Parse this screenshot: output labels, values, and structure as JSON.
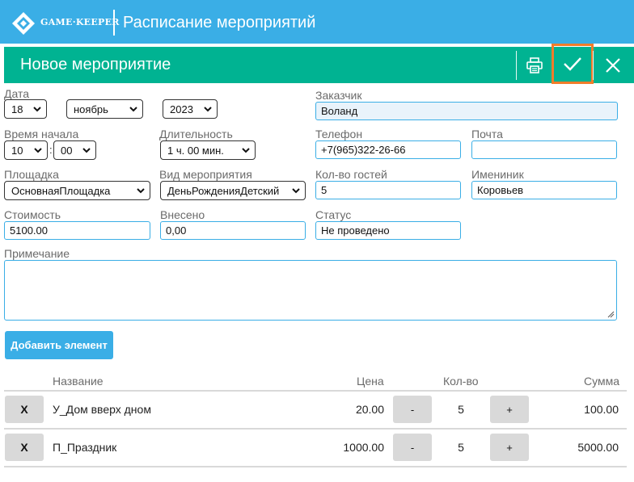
{
  "app": {
    "logo_text": "GAME·KEEPER",
    "title": "Расписание мероприятий"
  },
  "form_header": {
    "title": "Новое мероприятие",
    "print_icon": "printer-icon",
    "confirm_icon": "check-icon",
    "close_icon": "close-icon"
  },
  "fields": {
    "date": {
      "label": "Дата",
      "day": "18",
      "month": "ноябрь",
      "year": "2023"
    },
    "start_time": {
      "label": "Время начала",
      "hour": "10",
      "separator": ":",
      "minute": "00"
    },
    "duration": {
      "label": "Длительность",
      "value": "1 ч. 00 мин."
    },
    "customer": {
      "label": "Заказчик",
      "value": "Воланд"
    },
    "phone": {
      "label": "Телефон",
      "value": "+7(965)322-26-66"
    },
    "email": {
      "label": "Почта",
      "value": ""
    },
    "venue": {
      "label": "Площадка",
      "value": "ОсновнаяПлощадка"
    },
    "event_type": {
      "label": "Вид мероприятия",
      "value": "ДеньРожденияДетский"
    },
    "guests": {
      "label": "Кол-во гостей",
      "value": "5"
    },
    "birthday_person": {
      "label": "Имениник",
      "value": "Коровьев"
    },
    "cost": {
      "label": "Стоимость",
      "value": "5100.00"
    },
    "paid": {
      "label": "Внесено",
      "value": "0,00"
    },
    "status": {
      "label": "Статус",
      "value": "Не проведено"
    },
    "note": {
      "label": "Примечание",
      "value": ""
    }
  },
  "add_element_label": "Добавить элемент",
  "table": {
    "headers": {
      "name": "Название",
      "price": "Цена",
      "qty": "Кол-во",
      "sum": "Сумма"
    },
    "rows": [
      {
        "remove": "X",
        "name": "У_Дом вверх дном",
        "price": "20.00",
        "minus": "-",
        "qty": "5",
        "plus": "+",
        "sum": "100.00"
      },
      {
        "remove": "X",
        "name": "П_Праздник",
        "price": "1000.00",
        "minus": "-",
        "qty": "5",
        "plus": "+",
        "sum": "5000.00"
      }
    ]
  },
  "colors": {
    "app_bar": "#3aaee6",
    "form_header": "#00b392",
    "highlight": "#f07d2a"
  }
}
